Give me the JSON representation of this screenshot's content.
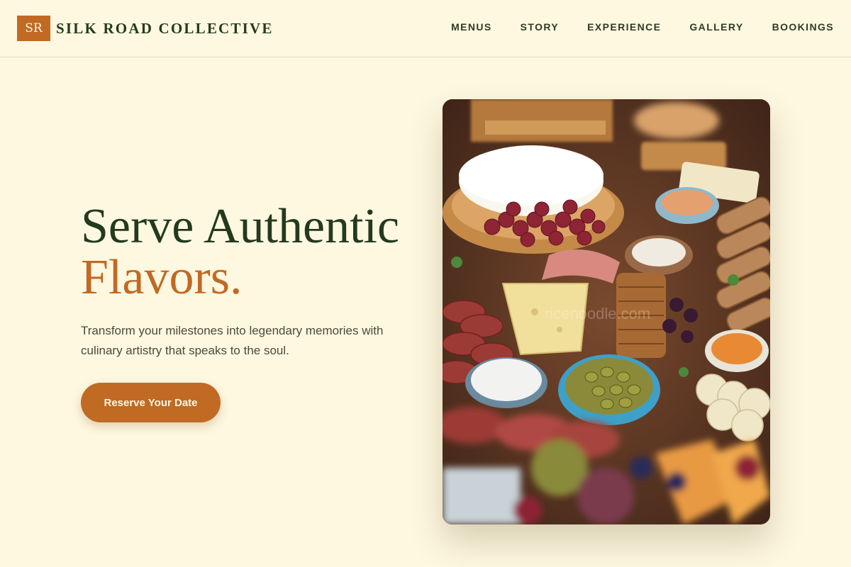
{
  "brand": {
    "mark": "SR",
    "name": "SILK ROAD COLLECTIVE"
  },
  "nav": [
    "MENUS",
    "STORY",
    "EXPERIENCE",
    "GALLERY",
    "BOOKINGS"
  ],
  "hero": {
    "title_line1": "Serve Authentic",
    "title_line2": "Flavors.",
    "subtitle": "Transform your milestones into legendary memories with culinary artistry that speaks to the soul.",
    "cta_label": "Reserve Your Date"
  },
  "photo": {
    "watermark": "ricenoodle.com"
  },
  "colors": {
    "background": "#fef8e0",
    "accent": "#c06a24",
    "heading": "#243a1e",
    "body_text": "#4a4a3c"
  }
}
